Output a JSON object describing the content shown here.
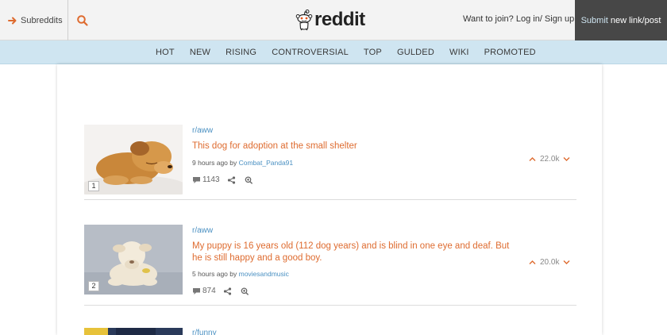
{
  "header": {
    "subreddits_label": "Subreddits",
    "logo_text": "reddit",
    "join_text": "Want to join? Log in/ Sign up",
    "submit_prefix": "Submit",
    "submit_suffix": "new link/post"
  },
  "nav": {
    "items": [
      "HOT",
      "NEW",
      "RISING",
      "CONTROVERSIAL",
      "TOP",
      "GULDED",
      "WIKI",
      "PROMOTED"
    ]
  },
  "posts": [
    {
      "rank": "1",
      "subreddit": "r/aww",
      "title": "This dog for adoption at the small shelter",
      "time": "9 hours ago by",
      "author": "Combat_Panda91",
      "comments": "1143",
      "score": "22.0k"
    },
    {
      "rank": "2",
      "subreddit": "r/aww",
      "title_line1": "My puppy is 16 years old (112 dog years) and is blind in one eye and deaf. But",
      "title_line2": "he is still happy and a good boy.",
      "time": "5 hours ago by",
      "author": "moviesandmusic",
      "comments": "874",
      "score": "20.0k"
    },
    {
      "subreddit": "r/funny"
    }
  ],
  "colors": {
    "accent": "#de6b2f",
    "link": "#4a90c2",
    "nav_bg": "#cfe5f1",
    "submit_bg": "#474747"
  },
  "icons": {
    "subreddits": "arrow-right-icon",
    "search": "search-icon",
    "logo": "reddit-alien-icon",
    "comments": "comment-bubble-icon",
    "share": "share-icon",
    "zoom": "zoom-icon",
    "upvote": "chevron-up-icon",
    "downvote": "chevron-down-icon"
  }
}
